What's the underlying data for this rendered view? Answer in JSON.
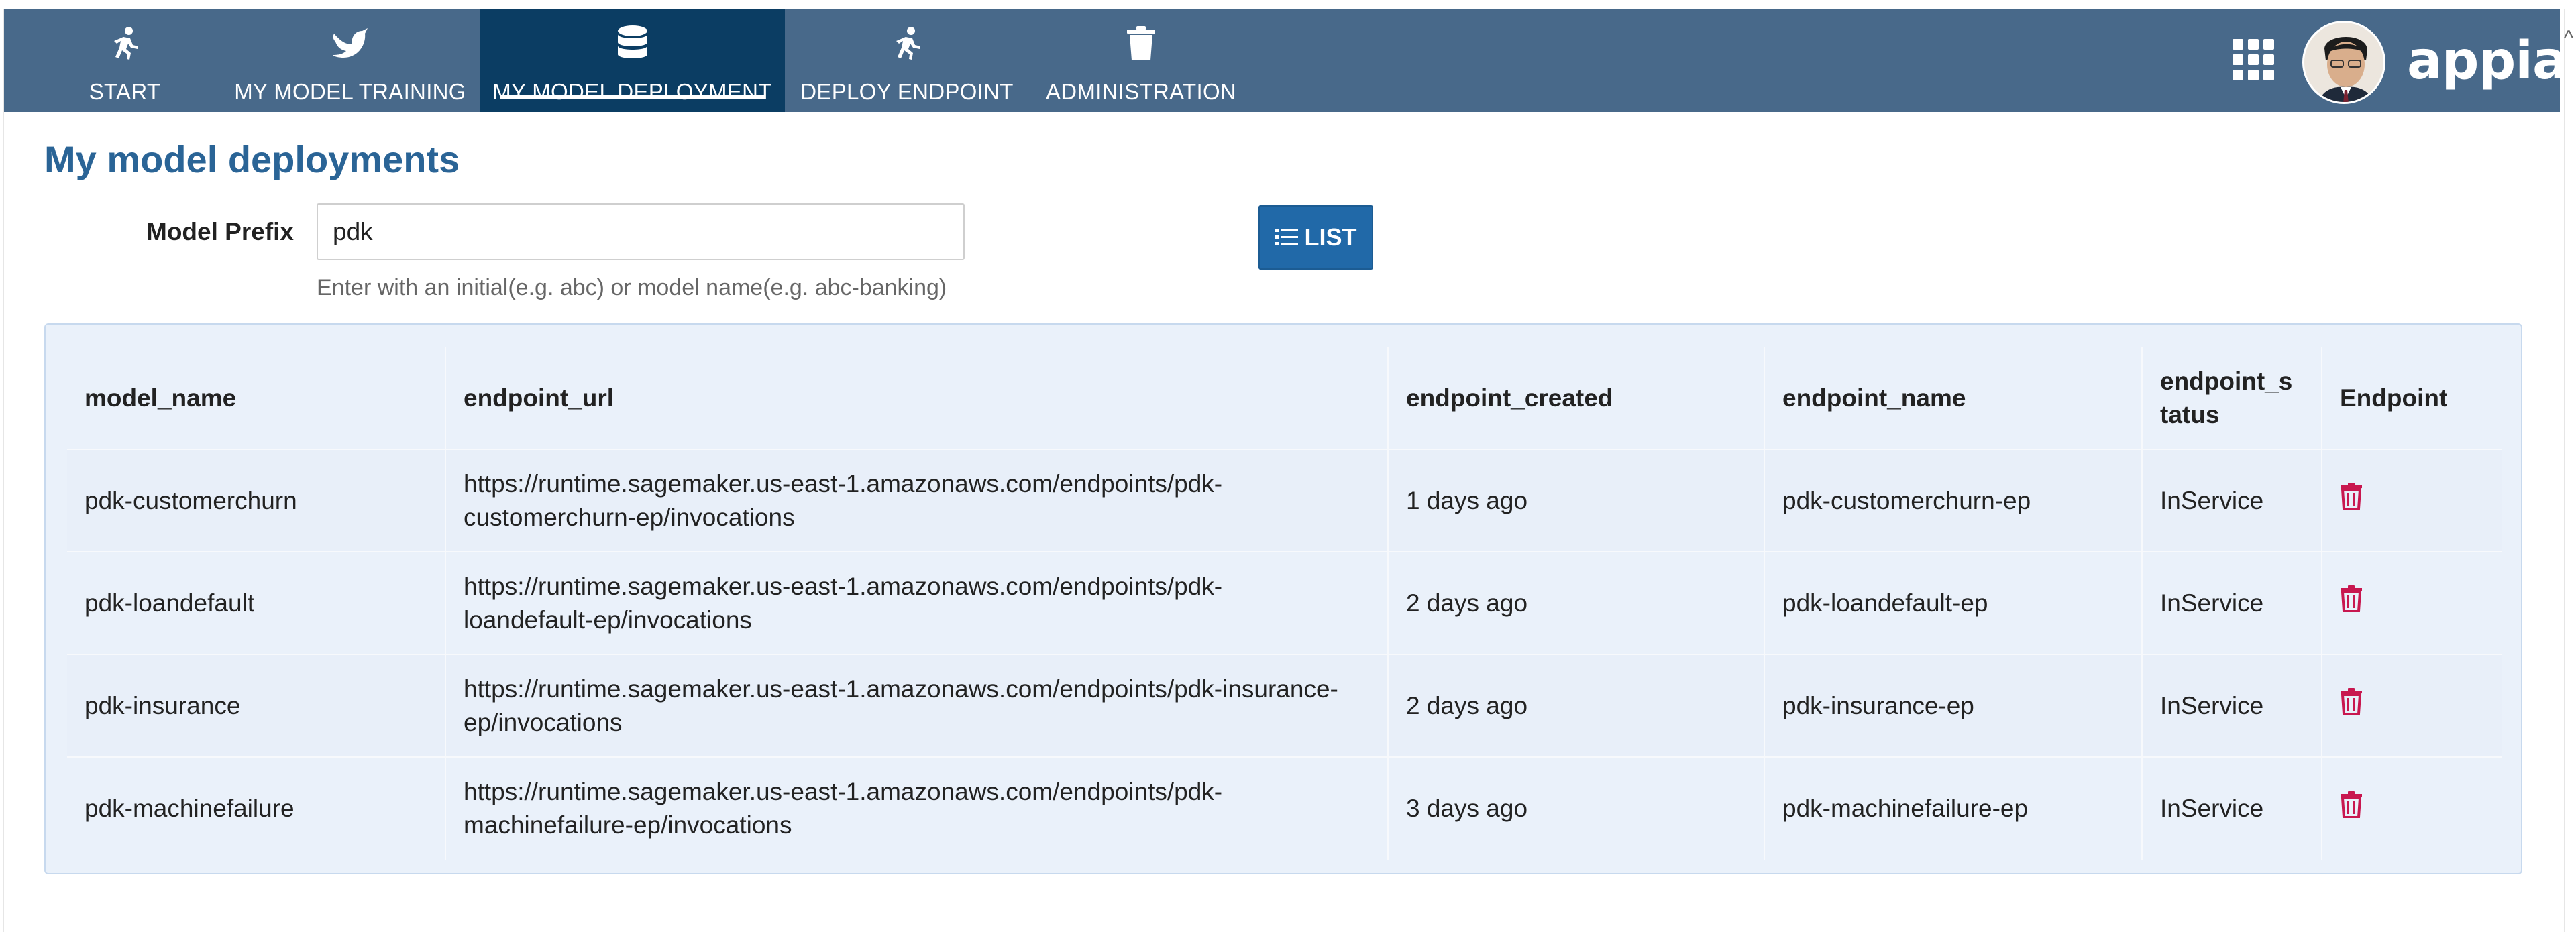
{
  "nav": {
    "tabs": [
      {
        "label": "START",
        "icon": "runner-icon"
      },
      {
        "label": "MY MODEL TRAINING",
        "icon": "bird-icon"
      },
      {
        "label": "MY MODEL DEPLOYMENT",
        "icon": "database-icon",
        "active": true
      },
      {
        "label": "DEPLOY ENDPOINT",
        "icon": "runner-icon"
      },
      {
        "label": "ADMINISTRATION",
        "icon": "trash-icon"
      }
    ],
    "logo": "appian"
  },
  "page": {
    "title": "My model deployments"
  },
  "form": {
    "prefix_label": "Model Prefix",
    "prefix_value": "pdk",
    "hint": "Enter with an initial(e.g. abc) or model name(e.g. abc-banking)",
    "list_button": "LIST"
  },
  "table": {
    "columns": [
      "model_name",
      "endpoint_url",
      "endpoint_created",
      "endpoint_name",
      "endpoint_s\ntatus",
      "Endpoint"
    ],
    "rows": [
      {
        "model_name": "pdk-customerchurn",
        "endpoint_url": "https://runtime.sagemaker.us-east-1.amazonaws.com/endpoints/pdk-customerchurn-ep/invocations",
        "endpoint_created": "1 days ago",
        "endpoint_name": "pdk-customerchurn-ep",
        "endpoint_status": "InService"
      },
      {
        "model_name": "pdk-loandefault",
        "endpoint_url": "https://runtime.sagemaker.us-east-1.amazonaws.com/endpoints/pdk-loandefault-ep/invocations",
        "endpoint_created": "2 days ago",
        "endpoint_name": "pdk-loandefault-ep",
        "endpoint_status": "InService"
      },
      {
        "model_name": "pdk-insurance",
        "endpoint_url": "https://runtime.sagemaker.us-east-1.amazonaws.com/endpoints/pdk-insurance-ep/invocations",
        "endpoint_created": "2 days ago",
        "endpoint_name": "pdk-insurance-ep",
        "endpoint_status": "InService"
      },
      {
        "model_name": "pdk-machinefailure",
        "endpoint_url": "https://runtime.sagemaker.us-east-1.amazonaws.com/endpoints/pdk-machinefailure-ep/invocations",
        "endpoint_created": "3 days ago",
        "endpoint_name": "pdk-machinefailure-ep",
        "endpoint_status": "InService"
      }
    ]
  },
  "colors": {
    "nav_bg": "#48698a",
    "nav_active_bg": "#0b3d63",
    "title": "#2a6496",
    "button": "#2169a8",
    "delete_icon": "#c8174f",
    "grid_bg": "#eaf1fa"
  }
}
